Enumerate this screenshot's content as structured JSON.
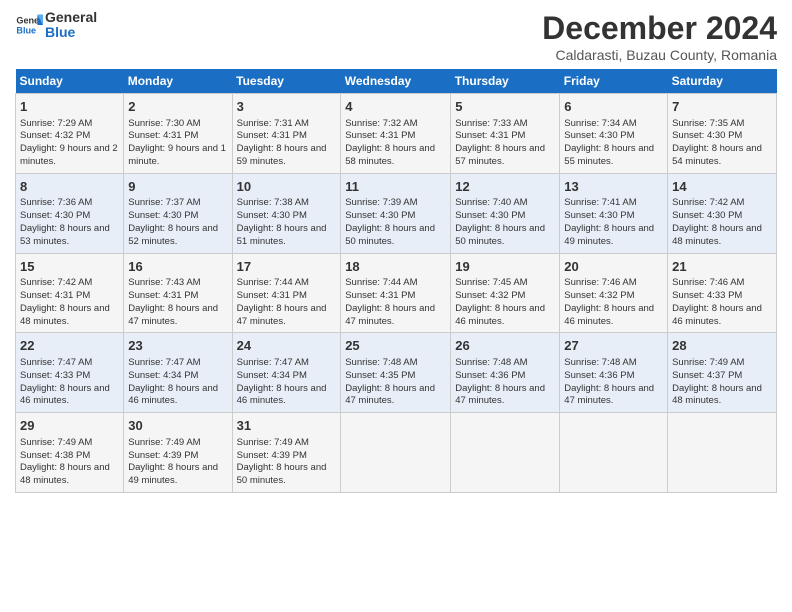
{
  "header": {
    "logo_line1": "General",
    "logo_line2": "Blue",
    "month": "December 2024",
    "location": "Caldarasti, Buzau County, Romania"
  },
  "days_of_week": [
    "Sunday",
    "Monday",
    "Tuesday",
    "Wednesday",
    "Thursday",
    "Friday",
    "Saturday"
  ],
  "weeks": [
    [
      {
        "day": "1",
        "sunrise": "Sunrise: 7:29 AM",
        "sunset": "Sunset: 4:32 PM",
        "daylight": "Daylight: 9 hours and 2 minutes."
      },
      {
        "day": "2",
        "sunrise": "Sunrise: 7:30 AM",
        "sunset": "Sunset: 4:31 PM",
        "daylight": "Daylight: 9 hours and 1 minute."
      },
      {
        "day": "3",
        "sunrise": "Sunrise: 7:31 AM",
        "sunset": "Sunset: 4:31 PM",
        "daylight": "Daylight: 8 hours and 59 minutes."
      },
      {
        "day": "4",
        "sunrise": "Sunrise: 7:32 AM",
        "sunset": "Sunset: 4:31 PM",
        "daylight": "Daylight: 8 hours and 58 minutes."
      },
      {
        "day": "5",
        "sunrise": "Sunrise: 7:33 AM",
        "sunset": "Sunset: 4:31 PM",
        "daylight": "Daylight: 8 hours and 57 minutes."
      },
      {
        "day": "6",
        "sunrise": "Sunrise: 7:34 AM",
        "sunset": "Sunset: 4:30 PM",
        "daylight": "Daylight: 8 hours and 55 minutes."
      },
      {
        "day": "7",
        "sunrise": "Sunrise: 7:35 AM",
        "sunset": "Sunset: 4:30 PM",
        "daylight": "Daylight: 8 hours and 54 minutes."
      }
    ],
    [
      {
        "day": "8",
        "sunrise": "Sunrise: 7:36 AM",
        "sunset": "Sunset: 4:30 PM",
        "daylight": "Daylight: 8 hours and 53 minutes."
      },
      {
        "day": "9",
        "sunrise": "Sunrise: 7:37 AM",
        "sunset": "Sunset: 4:30 PM",
        "daylight": "Daylight: 8 hours and 52 minutes."
      },
      {
        "day": "10",
        "sunrise": "Sunrise: 7:38 AM",
        "sunset": "Sunset: 4:30 PM",
        "daylight": "Daylight: 8 hours and 51 minutes."
      },
      {
        "day": "11",
        "sunrise": "Sunrise: 7:39 AM",
        "sunset": "Sunset: 4:30 PM",
        "daylight": "Daylight: 8 hours and 50 minutes."
      },
      {
        "day": "12",
        "sunrise": "Sunrise: 7:40 AM",
        "sunset": "Sunset: 4:30 PM",
        "daylight": "Daylight: 8 hours and 50 minutes."
      },
      {
        "day": "13",
        "sunrise": "Sunrise: 7:41 AM",
        "sunset": "Sunset: 4:30 PM",
        "daylight": "Daylight: 8 hours and 49 minutes."
      },
      {
        "day": "14",
        "sunrise": "Sunrise: 7:42 AM",
        "sunset": "Sunset: 4:30 PM",
        "daylight": "Daylight: 8 hours and 48 minutes."
      }
    ],
    [
      {
        "day": "15",
        "sunrise": "Sunrise: 7:42 AM",
        "sunset": "Sunset: 4:31 PM",
        "daylight": "Daylight: 8 hours and 48 minutes."
      },
      {
        "day": "16",
        "sunrise": "Sunrise: 7:43 AM",
        "sunset": "Sunset: 4:31 PM",
        "daylight": "Daylight: 8 hours and 47 minutes."
      },
      {
        "day": "17",
        "sunrise": "Sunrise: 7:44 AM",
        "sunset": "Sunset: 4:31 PM",
        "daylight": "Daylight: 8 hours and 47 minutes."
      },
      {
        "day": "18",
        "sunrise": "Sunrise: 7:44 AM",
        "sunset": "Sunset: 4:31 PM",
        "daylight": "Daylight: 8 hours and 47 minutes."
      },
      {
        "day": "19",
        "sunrise": "Sunrise: 7:45 AM",
        "sunset": "Sunset: 4:32 PM",
        "daylight": "Daylight: 8 hours and 46 minutes."
      },
      {
        "day": "20",
        "sunrise": "Sunrise: 7:46 AM",
        "sunset": "Sunset: 4:32 PM",
        "daylight": "Daylight: 8 hours and 46 minutes."
      },
      {
        "day": "21",
        "sunrise": "Sunrise: 7:46 AM",
        "sunset": "Sunset: 4:33 PM",
        "daylight": "Daylight: 8 hours and 46 minutes."
      }
    ],
    [
      {
        "day": "22",
        "sunrise": "Sunrise: 7:47 AM",
        "sunset": "Sunset: 4:33 PM",
        "daylight": "Daylight: 8 hours and 46 minutes."
      },
      {
        "day": "23",
        "sunrise": "Sunrise: 7:47 AM",
        "sunset": "Sunset: 4:34 PM",
        "daylight": "Daylight: 8 hours and 46 minutes."
      },
      {
        "day": "24",
        "sunrise": "Sunrise: 7:47 AM",
        "sunset": "Sunset: 4:34 PM",
        "daylight": "Daylight: 8 hours and 46 minutes."
      },
      {
        "day": "25",
        "sunrise": "Sunrise: 7:48 AM",
        "sunset": "Sunset: 4:35 PM",
        "daylight": "Daylight: 8 hours and 47 minutes."
      },
      {
        "day": "26",
        "sunrise": "Sunrise: 7:48 AM",
        "sunset": "Sunset: 4:36 PM",
        "daylight": "Daylight: 8 hours and 47 minutes."
      },
      {
        "day": "27",
        "sunrise": "Sunrise: 7:48 AM",
        "sunset": "Sunset: 4:36 PM",
        "daylight": "Daylight: 8 hours and 47 minutes."
      },
      {
        "day": "28",
        "sunrise": "Sunrise: 7:49 AM",
        "sunset": "Sunset: 4:37 PM",
        "daylight": "Daylight: 8 hours and 48 minutes."
      }
    ],
    [
      {
        "day": "29",
        "sunrise": "Sunrise: 7:49 AM",
        "sunset": "Sunset: 4:38 PM",
        "daylight": "Daylight: 8 hours and 48 minutes."
      },
      {
        "day": "30",
        "sunrise": "Sunrise: 7:49 AM",
        "sunset": "Sunset: 4:39 PM",
        "daylight": "Daylight: 8 hours and 49 minutes."
      },
      {
        "day": "31",
        "sunrise": "Sunrise: 7:49 AM",
        "sunset": "Sunset: 4:39 PM",
        "daylight": "Daylight: 8 hours and 50 minutes."
      },
      null,
      null,
      null,
      null
    ]
  ]
}
